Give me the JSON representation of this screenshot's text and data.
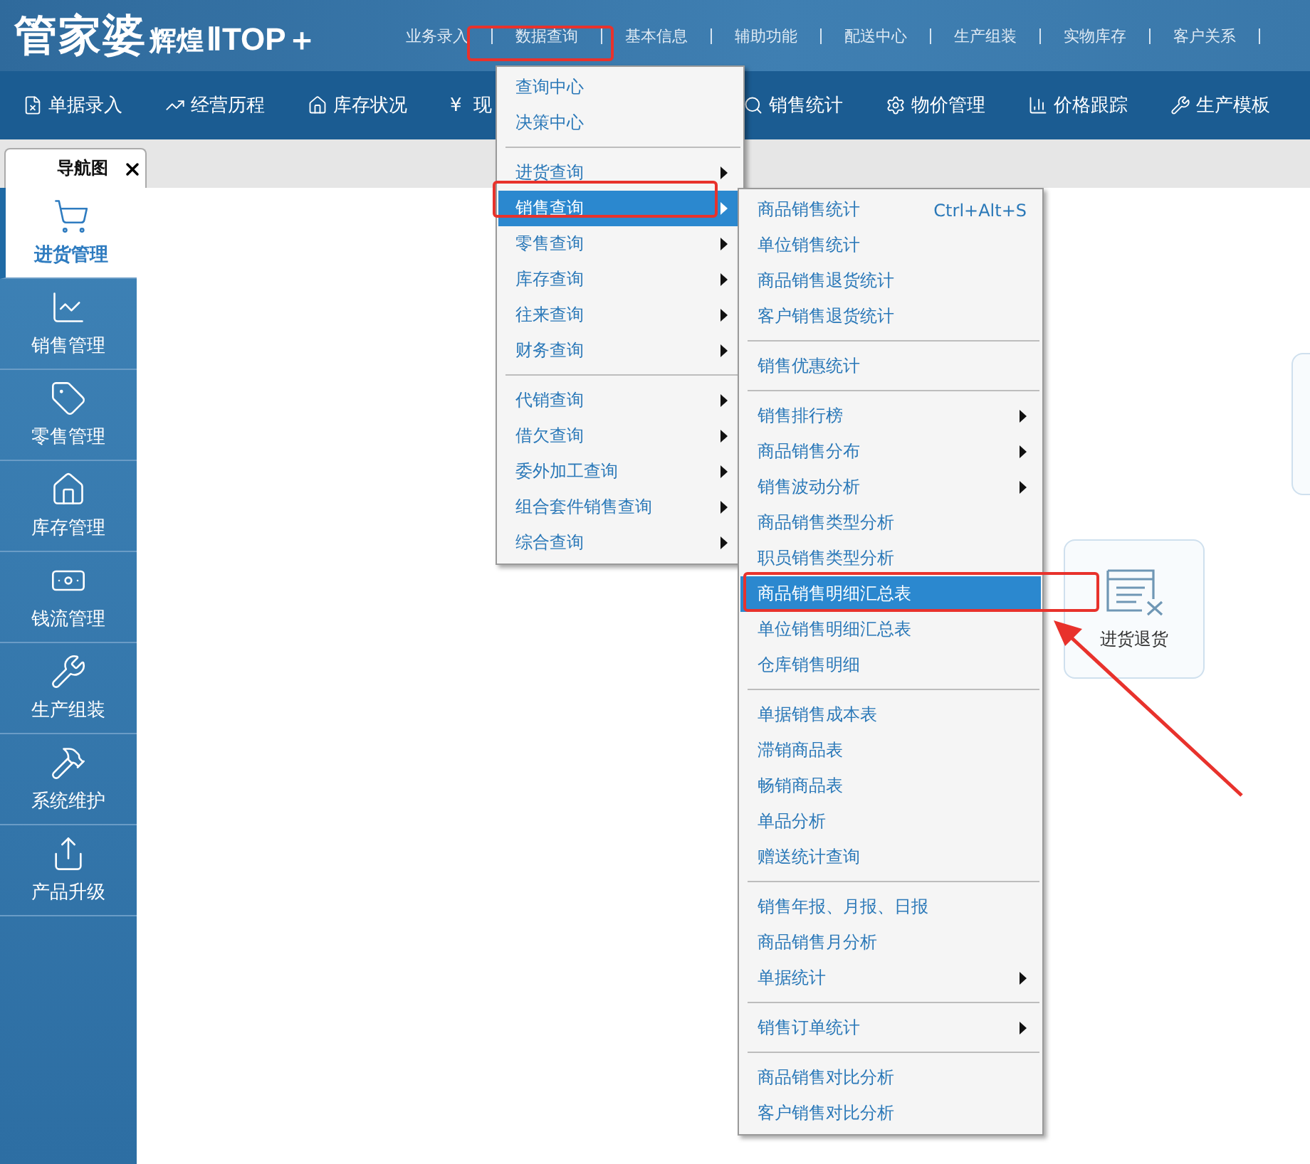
{
  "logo": {
    "brand": "管家婆",
    "edition": "辉煌",
    "version": "ⅡTOP＋"
  },
  "top_nav": [
    {
      "label": "业务录入"
    },
    {
      "label": "数据查询"
    },
    {
      "label": "基本信息"
    },
    {
      "label": "辅助功能"
    },
    {
      "label": "配送中心"
    },
    {
      "label": "生产组装"
    },
    {
      "label": "实物库存"
    },
    {
      "label": "客户关系"
    }
  ],
  "toolbar": [
    {
      "label": "单据录入"
    },
    {
      "label": "经营历程"
    },
    {
      "label": "库存状况"
    },
    {
      "label": "现",
      "symbol": "¥"
    },
    {
      "label": "销售统计"
    },
    {
      "label": "物价管理"
    },
    {
      "label": "价格跟踪"
    },
    {
      "label": "生产模板"
    }
  ],
  "tab": {
    "label": "导航图"
  },
  "sidebar": [
    {
      "label": "进货管理",
      "selected": true
    },
    {
      "label": "销售管理",
      "selected": false
    },
    {
      "label": "零售管理",
      "selected": false
    },
    {
      "label": "库存管理",
      "selected": false
    },
    {
      "label": "钱流管理",
      "selected": false
    },
    {
      "label": "生产组装",
      "selected": false
    },
    {
      "label": "系统维护",
      "selected": false
    },
    {
      "label": "产品升级",
      "selected": false
    }
  ],
  "cards": [
    {
      "label": "进货退货"
    }
  ],
  "menu": {
    "groups": [
      [
        {
          "label": "查询中心",
          "submenu": false,
          "selected": false
        },
        {
          "label": "决策中心",
          "submenu": false,
          "selected": false
        }
      ],
      [
        {
          "label": "进货查询",
          "submenu": true,
          "selected": false
        },
        {
          "label": "销售查询",
          "submenu": true,
          "selected": true
        },
        {
          "label": "零售查询",
          "submenu": true,
          "selected": false
        },
        {
          "label": "库存查询",
          "submenu": true,
          "selected": false
        },
        {
          "label": "往来查询",
          "submenu": true,
          "selected": false
        },
        {
          "label": "财务查询",
          "submenu": true,
          "selected": false
        }
      ],
      [
        {
          "label": "代销查询",
          "submenu": true,
          "selected": false
        },
        {
          "label": "借欠查询",
          "submenu": true,
          "selected": false
        },
        {
          "label": "委外加工查询",
          "submenu": true,
          "selected": false
        },
        {
          "label": "组合套件销售查询",
          "submenu": true,
          "selected": false
        },
        {
          "label": "综合查询",
          "submenu": true,
          "selected": false
        }
      ]
    ]
  },
  "submenu": {
    "groups": [
      [
        {
          "label": "商品销售统计",
          "shortcut": "Ctrl+Alt+S",
          "submenu": false,
          "selected": false
        },
        {
          "label": "单位销售统计",
          "submenu": false,
          "selected": false
        },
        {
          "label": "商品销售退货统计",
          "submenu": false,
          "selected": false
        },
        {
          "label": "客户销售退货统计",
          "submenu": false,
          "selected": false
        }
      ],
      [
        {
          "label": "销售优惠统计",
          "submenu": false,
          "selected": false
        }
      ],
      [
        {
          "label": "销售排行榜",
          "submenu": true,
          "selected": false
        },
        {
          "label": "商品销售分布",
          "submenu": true,
          "selected": false
        },
        {
          "label": "销售波动分析",
          "submenu": true,
          "selected": false
        },
        {
          "label": "商品销售类型分析",
          "submenu": false,
          "selected": false
        },
        {
          "label": "职员销售类型分析",
          "submenu": false,
          "selected": false
        },
        {
          "label": "商品销售明细汇总表",
          "submenu": false,
          "selected": true
        },
        {
          "label": "单位销售明细汇总表",
          "submenu": false,
          "selected": false
        },
        {
          "label": "仓库销售明细",
          "submenu": false,
          "selected": false
        }
      ],
      [
        {
          "label": "单据销售成本表",
          "submenu": false,
          "selected": false
        },
        {
          "label": "滞销商品表",
          "submenu": false,
          "selected": false
        },
        {
          "label": "畅销商品表",
          "submenu": false,
          "selected": false
        },
        {
          "label": "单品分析",
          "submenu": false,
          "selected": false
        },
        {
          "label": "赠送统计查询",
          "submenu": false,
          "selected": false
        }
      ],
      [
        {
          "label": "销售年报、月报、日报",
          "submenu": false,
          "selected": false
        },
        {
          "label": "商品销售月分析",
          "submenu": false,
          "selected": false
        },
        {
          "label": "单据统计",
          "submenu": true,
          "selected": false
        }
      ],
      [
        {
          "label": "销售订单统计",
          "submenu": true,
          "selected": false
        }
      ],
      [
        {
          "label": "商品销售对比分析",
          "submenu": false,
          "selected": false
        },
        {
          "label": "客户销售对比分析",
          "submenu": false,
          "selected": false
        }
      ]
    ]
  }
}
